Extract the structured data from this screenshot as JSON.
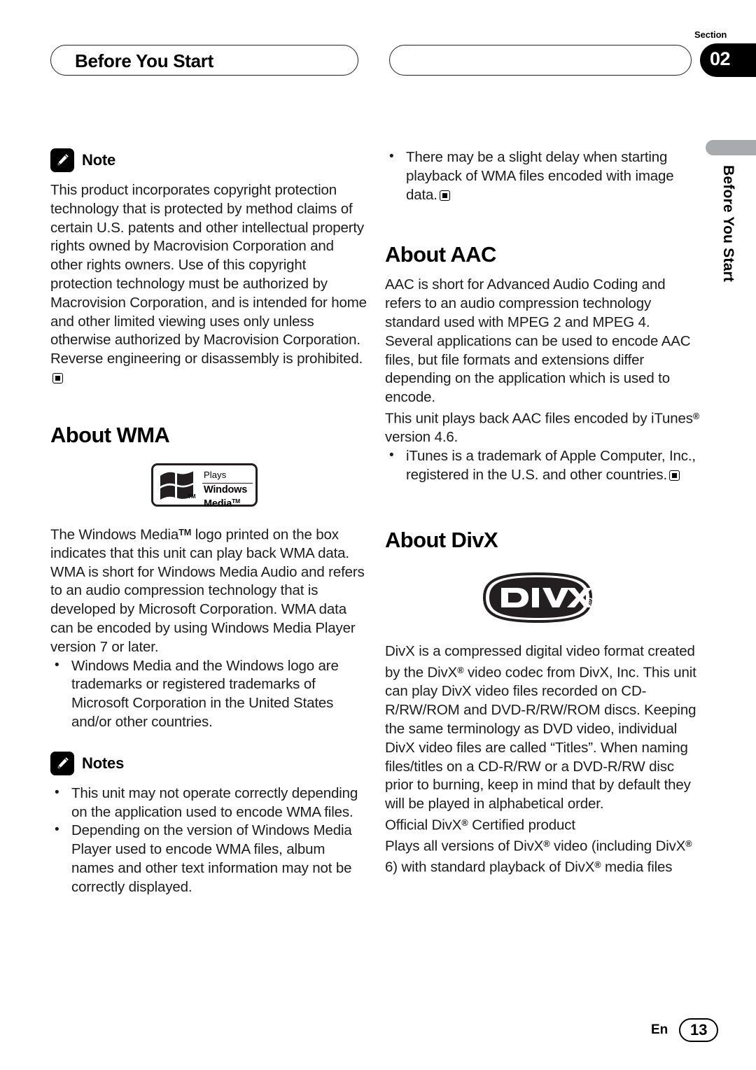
{
  "header": {
    "chapter_title": "Before You Start",
    "section_label": "Section",
    "section_number": "02"
  },
  "side_tab": {
    "text": "Before You Start"
  },
  "left_column": {
    "note": {
      "icon": "pencil-icon",
      "title": "Note",
      "body": "This product incorporates copyright protection technology that is protected by method claims of certain U.S. patents and other intellectual property rights owned by Macrovision Corporation and other rights owners. Use of this copyright protection technology must be authorized by Macrovision Corporation, and is intended for home and other limited viewing uses only unless otherwise authorized by Macrovision Corporation. Reverse engineering or disassembly is prohibited."
    },
    "wma_section": {
      "heading": "About WMA",
      "logo": {
        "plays": "Plays",
        "brand_line1": "Windows",
        "brand_line2": "Media",
        "brand_tm": "TM",
        "flag_tm": "TM"
      },
      "paragraph1_part1": "The Windows Media",
      "paragraph1_tm": "TM",
      "paragraph1_part2": " logo printed on the box indicates that this unit can play back WMA data.",
      "paragraph2": "WMA is short for Windows Media Audio and refers to an audio compression technology that is developed by Microsoft Corporation. WMA data can be encoded by using Windows Media Player version 7 or later.",
      "bullets": [
        "Windows Media and the Windows logo are trademarks or registered trademarks of Microsoft Corporation in the United States and/or other countries."
      ]
    },
    "notes_block": {
      "icon": "pencil-icon",
      "title": "Notes",
      "bullets": [
        "This unit may not operate correctly depending on the application used to encode WMA files.",
        "Depending on the version of Windows Media Player used to encode WMA files, album names and other text information may not be correctly displayed."
      ]
    }
  },
  "right_column": {
    "top_bullet": "There may be a slight delay when starting playback of WMA files encoded with image data.",
    "aac_section": {
      "heading": "About AAC",
      "paragraph1": "AAC is short for Advanced Audio Coding and refers to an audio compression technology standard used with MPEG 2 and MPEG 4. Several applications can be used to encode AAC files, but file formats and extensions differ depending on the application which is used to encode.",
      "paragraph2_part1": "This unit plays back AAC files encoded by iTunes",
      "paragraph2_reg": "®",
      "paragraph2_part2": " version 4.6.",
      "bullet": "iTunes is a trademark of Apple Computer, Inc., registered in the U.S. and other countries."
    },
    "divx_section": {
      "heading": "About DivX",
      "logo_text": "DivX",
      "logo_reg": "®",
      "paragraph_line1": "DivX is a compressed digital video format created by the DivX",
      "paragraph_reg1": "®",
      "paragraph_line2": " video codec from DivX, Inc. This unit can play DivX video files recorded on CD-R/RW/ROM and DVD-R/RW/ROM discs. Keeping the same terminology as DVD video, individual DivX video files are called “Titles”. When naming files/titles on a CD-R/RW or a DVD-R/RW disc prior to burning, keep in mind that by default they will be played in alphabetical order.",
      "certified_part1": "Official DivX",
      "certified_reg": "®",
      "certified_part2": " Certified product",
      "plays_part1": "Plays all versions of DivX",
      "plays_reg1": "®",
      "plays_part2": " video (including DivX",
      "plays_reg2": "®",
      "plays_part3": " 6) with standard playback of DivX",
      "plays_reg3": "®",
      "plays_part4": " media files"
    }
  },
  "footer": {
    "language": "En",
    "page_number": "13"
  },
  "colors": {
    "section_tab_bg": "#000000",
    "side_bar": "#a7abad",
    "text": "#1c1c1c"
  }
}
